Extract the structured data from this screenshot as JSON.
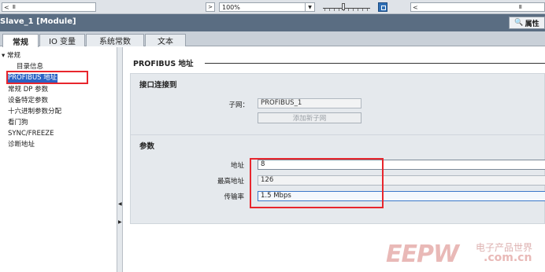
{
  "toolbar": {
    "zoom_value": "100%",
    "scroll_left_arrow": "<",
    "scroll_right_arrow": "<",
    "nav_arrow": ">",
    "scroll_grip": "III"
  },
  "title_bar": {
    "title": "Slave_1 [Module]",
    "properties_label": "属性"
  },
  "tabs": [
    {
      "label": "常规"
    },
    {
      "label": "IO 变量"
    },
    {
      "label": "系统常数"
    },
    {
      "label": "文本"
    }
  ],
  "tree": {
    "items": [
      {
        "label": "常规"
      },
      {
        "label": "目录信息"
      },
      {
        "label": "PROFIBUS 地址"
      },
      {
        "label": "常规 DP 参数"
      },
      {
        "label": "设备特定参数"
      },
      {
        "label": "十六进制参数分配"
      },
      {
        "label": "看门狗"
      },
      {
        "label": "SYNC/FREEZE"
      },
      {
        "label": "诊断地址"
      }
    ]
  },
  "content": {
    "section_title": "PROFIBUS 地址",
    "interface_group": {
      "heading": "接口连接到",
      "subnet_label": "子网：",
      "subnet_value": "PROFIBUS_1",
      "add_subnet_button": "添加新子网"
    },
    "params_group": {
      "heading": "参数",
      "address_label": "地址",
      "address_value": "8",
      "max_address_label": "最高地址",
      "max_address_value": "126",
      "baud_label": "传输率",
      "baud_value": "1.5 Mbps"
    }
  },
  "watermark": {
    "logo": "EEPW",
    "chinese": "电子产品世界",
    "domain": ".com.cn"
  },
  "colors": {
    "selection_blue": "#2b63c5",
    "highlight_red": "#e8262d",
    "titlebar": "#5a6d82"
  }
}
